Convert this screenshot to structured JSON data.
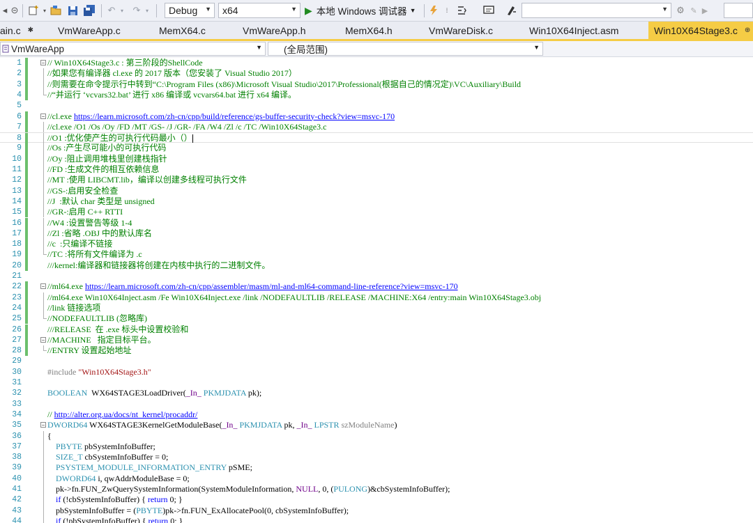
{
  "toolbar": {
    "config": "Debug",
    "platform": "x64",
    "run_label": "本地 Windows 调试器",
    "search_value": ""
  },
  "tabs": [
    {
      "label": "ain.c",
      "pin": "✱"
    },
    {
      "label": "VmWareApp.c"
    },
    {
      "label": "MemX64.c"
    },
    {
      "label": "VmWareApp.h"
    },
    {
      "label": "MemX64.h"
    },
    {
      "label": "VmWareDisk.c"
    },
    {
      "label": "Win10X64Inject.asm"
    },
    {
      "label": "Win10X64Stage3.c",
      "active": true,
      "pin": "⊕"
    }
  ],
  "navbar": {
    "project": "VmWareApp",
    "scope": "(全局范围)"
  },
  "colors": {
    "active_tab": "#f5cc45",
    "comment": "#008000",
    "keyword": "#0000ff",
    "type": "#2b91af",
    "macro": "#6f008a",
    "string": "#a31515",
    "line_number": "#2b91af"
  },
  "lines": [
    {
      "n": 1,
      "fold": "⊟",
      "segs": [
        [
          "cm",
          "// Win10X64Stage3.c : 第三阶段的ShellCode"
        ]
      ]
    },
    {
      "n": 2,
      "guide": true,
      "segs": [
        [
          "cm",
          "//如果您有编译器 cl.exe 的 2017 版本（您安装了 Visual Studio 2017）"
        ]
      ]
    },
    {
      "n": 3,
      "guide": true,
      "segs": [
        [
          "cm",
          "//则需要在命令提示行中转到“C:\\Program Files (x86)\\Microsoft Visual Studio\\2017\\Professional(根据自己的情况定)\\VC\\Auxiliary\\Build"
        ]
      ]
    },
    {
      "n": 4,
      "guideEnd": true,
      "segs": [
        [
          "cm",
          "//“并运行 ‘vcvars32.bat’ 进行 x86 编译或 vcvars64.bat 进行 x64 编译。"
        ]
      ]
    },
    {
      "n": 5,
      "segs": []
    },
    {
      "n": 6,
      "fold": "⊟",
      "segs": [
        [
          "cm",
          "//cl.exe "
        ],
        [
          "lnk",
          "https://learn.microsoft.com/zh-cn/cpp/build/reference/gs-buffer-security-check?view=msvc-170"
        ]
      ]
    },
    {
      "n": 7,
      "guide": true,
      "segs": [
        [
          "cm",
          "//cl.exe /O1 /Os /Oy /FD /MT /GS- /J /GR- /FA /W4 /Zl /c /TC /Win10X64Stage3.c"
        ]
      ]
    },
    {
      "n": 8,
      "guide": true,
      "caret": true,
      "segs": [
        [
          "cm",
          "//O1 :优化使产生的可执行代码最小（）"
        ]
      ]
    },
    {
      "n": 9,
      "guide": true,
      "segs": [
        [
          "cm",
          "//Os :产生尽可能小的可执行代码"
        ]
      ]
    },
    {
      "n": 10,
      "guide": true,
      "segs": [
        [
          "cm",
          "//Oy :阻止调用堆栈里创建栈指针"
        ]
      ]
    },
    {
      "n": 11,
      "guide": true,
      "segs": [
        [
          "cm",
          "//FD :生成文件的相互依赖信息"
        ]
      ]
    },
    {
      "n": 12,
      "guide": true,
      "segs": [
        [
          "cm",
          "//MT :使用 LIBCMT.lib，编译以创建多线程可执行文件"
        ]
      ]
    },
    {
      "n": 13,
      "guide": true,
      "segs": [
        [
          "cm",
          "//GS-:启用安全检查"
        ]
      ]
    },
    {
      "n": 14,
      "guide": true,
      "segs": [
        [
          "cm",
          "//J  :默认 char 类型是 unsigned"
        ]
      ]
    },
    {
      "n": 15,
      "guide": true,
      "segs": [
        [
          "cm",
          "//GR-:启用 C++ RTTI"
        ]
      ]
    },
    {
      "n": 16,
      "guide": true,
      "segs": [
        [
          "cm",
          "//W4 :设置警告等级 1-4"
        ]
      ]
    },
    {
      "n": 17,
      "guide": true,
      "segs": [
        [
          "cm",
          "//Zl :省略 .OBJ 中的默认库名"
        ]
      ]
    },
    {
      "n": 18,
      "guide": true,
      "segs": [
        [
          "cm",
          "//c  :只编译不链接"
        ]
      ]
    },
    {
      "n": 19,
      "guideEnd": true,
      "segs": [
        [
          "cm",
          "//TC :将所有文件编译为 .c"
        ]
      ]
    },
    {
      "n": 20,
      "segs": [
        [
          "cm",
          "///kernel:编译器和链接器将创建在内核中执行的二进制文件。"
        ]
      ]
    },
    {
      "n": 21,
      "segs": []
    },
    {
      "n": 22,
      "fold": "⊟",
      "segs": [
        [
          "cm",
          "//ml64.exe "
        ],
        [
          "lnk",
          "https://learn.microsoft.com/zh-cn/cpp/assembler/masm/ml-and-ml64-command-line-reference?view=msvc-170"
        ]
      ]
    },
    {
      "n": 23,
      "guide": true,
      "segs": [
        [
          "cm",
          "//ml64.exe Win10X64Inject.asm /Fe Win10X64Inject.exe /link /NODEFAULTLIB /RELEASE /MACHINE:X64 /entry:main Win10X64Stage3.obj"
        ]
      ]
    },
    {
      "n": 24,
      "guide": true,
      "segs": [
        [
          "cm",
          "//link 链接选项"
        ]
      ]
    },
    {
      "n": 25,
      "guideEnd": true,
      "segs": [
        [
          "cm",
          "//NODEFAULTLIB (忽略库)"
        ]
      ]
    },
    {
      "n": 26,
      "segs": [
        [
          "cm",
          "///RELEASE  在 .exe 标头中设置校验和"
        ]
      ]
    },
    {
      "n": 27,
      "fold": "⊟",
      "segs": [
        [
          "cm",
          "//MACHINE   指定目标平台。"
        ]
      ]
    },
    {
      "n": 28,
      "guideEnd": true,
      "segs": [
        [
          "cm",
          "//ENTRY 设置起始地址"
        ]
      ]
    },
    {
      "n": 29,
      "segs": []
    },
    {
      "n": 30,
      "segs": [
        [
          "pp",
          "#include "
        ],
        [
          "str",
          "\"Win10X64Stage3.h\""
        ]
      ]
    },
    {
      "n": 31,
      "segs": []
    },
    {
      "n": 32,
      "segs": [
        [
          "ty",
          "BOOLEAN"
        ],
        [
          "",
          "  WX64STAGE3LoadDriver("
        ],
        [
          "mac",
          "_In_"
        ],
        [
          "",
          ""
        ],
        [
          "ty",
          " PKMJDATA"
        ],
        [
          "",
          " pk);"
        ]
      ]
    },
    {
      "n": 33,
      "segs": []
    },
    {
      "n": 34,
      "segs": [
        [
          "cm",
          "// "
        ],
        [
          "lnk",
          "http://alter.org.ua/docs/nt_kernel/procaddr/"
        ]
      ]
    },
    {
      "n": 35,
      "fold": "⊟",
      "segs": [
        [
          "ty",
          "DWORD64"
        ],
        [
          "",
          " WX64STAGE3KernelGetModuleBase("
        ],
        [
          "mac",
          "_In_"
        ],
        [
          "ty",
          " PKMJDATA"
        ],
        [
          "",
          " pk, "
        ],
        [
          "mac",
          "_In_"
        ],
        [
          "ty",
          " LPSTR"
        ],
        [
          "pp",
          " szModuleName"
        ],
        [
          "",
          ")"
        ]
      ]
    },
    {
      "n": 36,
      "guide": true,
      "segs": [
        [
          "",
          "{"
        ]
      ]
    },
    {
      "n": 37,
      "guide": true,
      "segs": [
        [
          "",
          "    "
        ],
        [
          "ty",
          "PBYTE"
        ],
        [
          "",
          " pbSystemInfoBuffer;"
        ]
      ]
    },
    {
      "n": 38,
      "guide": true,
      "segs": [
        [
          "",
          "    "
        ],
        [
          "ty",
          "SIZE_T"
        ],
        [
          "",
          " cbSystemInfoBuffer = 0;"
        ]
      ]
    },
    {
      "n": 39,
      "guide": true,
      "segs": [
        [
          "",
          "    "
        ],
        [
          "ty",
          "PSYSTEM_MODULE_INFORMATION_ENTRY"
        ],
        [
          "",
          " pSME;"
        ]
      ]
    },
    {
      "n": 40,
      "guide": true,
      "segs": [
        [
          "",
          "    "
        ],
        [
          "ty",
          "DWORD64"
        ],
        [
          "",
          " i, qwAddrModuleBase = 0;"
        ]
      ]
    },
    {
      "n": 41,
      "guide": true,
      "segs": [
        [
          "",
          "    pk->fn.FUN_ZwQuerySystemInformation(SystemModuleInformation, "
        ],
        [
          "mac",
          "NULL"
        ],
        [
          "",
          ", 0, ("
        ],
        [
          "ty",
          "PULONG"
        ],
        [
          "",
          ")&cbSystemInfoBuffer);"
        ]
      ]
    },
    {
      "n": 42,
      "guide": true,
      "segs": [
        [
          "",
          "    "
        ],
        [
          "kw",
          "if"
        ],
        [
          "",
          " (!cbSystemInfoBuffer) { "
        ],
        [
          "kw",
          "return"
        ],
        [
          "",
          " 0; }"
        ]
      ]
    },
    {
      "n": 43,
      "guide": true,
      "segs": [
        [
          "",
          "    pbSystemInfoBuffer = ("
        ],
        [
          "ty",
          "PBYTE"
        ],
        [
          "",
          ")pk->fn.FUN_ExAllocatePool(0, cbSystemInfoBuffer);"
        ]
      ]
    },
    {
      "n": 44,
      "guide": true,
      "segs": [
        [
          "",
          "    "
        ],
        [
          "kw",
          "if"
        ],
        [
          "",
          " (!pbSystemInfoBuffer) { "
        ],
        [
          "kw",
          "return"
        ],
        [
          "",
          " 0; }"
        ]
      ]
    }
  ]
}
